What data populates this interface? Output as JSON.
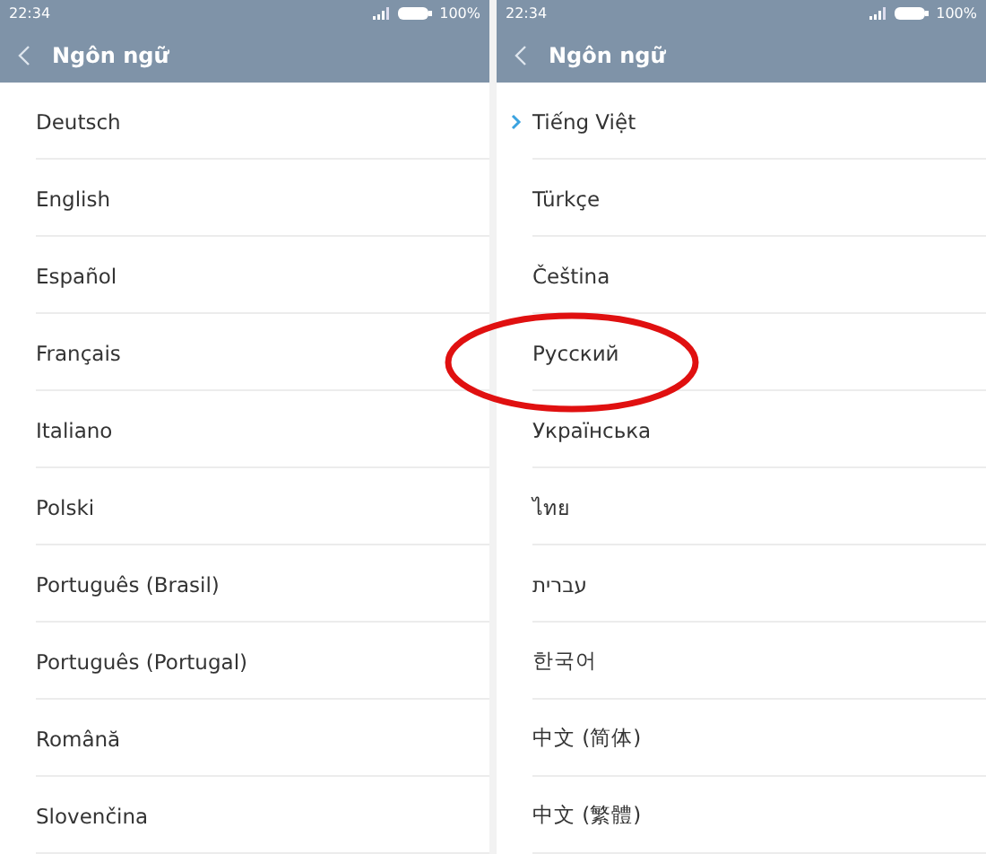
{
  "panels": [
    {
      "status_bar": {
        "time": "22:34",
        "battery": "100%"
      },
      "title": "Ngôn ngữ",
      "items": [
        {
          "label": "Deutsch",
          "selected": false,
          "circled": false
        },
        {
          "label": "English",
          "selected": false,
          "circled": false
        },
        {
          "label": "Español",
          "selected": false,
          "circled": false
        },
        {
          "label": "Français",
          "selected": false,
          "circled": false
        },
        {
          "label": "Italiano",
          "selected": false,
          "circled": false
        },
        {
          "label": "Polski",
          "selected": false,
          "circled": false
        },
        {
          "label": "Português (Brasil)",
          "selected": false,
          "circled": false
        },
        {
          "label": "Português (Portugal)",
          "selected": false,
          "circled": false
        },
        {
          "label": "Română",
          "selected": false,
          "circled": false
        },
        {
          "label": "Slovenčina",
          "selected": false,
          "circled": false
        }
      ]
    },
    {
      "status_bar": {
        "time": "22:34",
        "battery": "100%"
      },
      "title": "Ngôn ngữ",
      "items": [
        {
          "label": "Tiếng Việt",
          "selected": true,
          "circled": false
        },
        {
          "label": "Türkçe",
          "selected": false,
          "circled": false
        },
        {
          "label": "Čeština",
          "selected": false,
          "circled": false
        },
        {
          "label": "Русский",
          "selected": false,
          "circled": true
        },
        {
          "label": "Українська",
          "selected": false,
          "circled": false
        },
        {
          "label": "ไทย",
          "selected": false,
          "circled": false
        },
        {
          "label": "עברית",
          "selected": false,
          "circled": false
        },
        {
          "label": "한국어",
          "selected": false,
          "circled": false
        },
        {
          "label": "中文 (简体)",
          "selected": false,
          "circled": false
        },
        {
          "label": "中文 (繁體)",
          "selected": false,
          "circled": false
        }
      ]
    }
  ]
}
